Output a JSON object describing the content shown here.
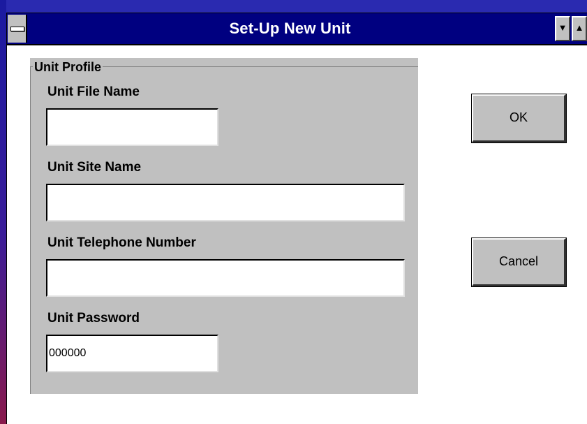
{
  "window": {
    "title": "Set-Up New Unit",
    "minimize_glyph": "▼",
    "maximize_glyph": "▲"
  },
  "group": {
    "legend": "Unit Profile"
  },
  "fields": {
    "unit_file_name": {
      "label": "Unit File Name",
      "value": ""
    },
    "unit_site_name": {
      "label": "Unit Site Name",
      "value": ""
    },
    "unit_telephone_number": {
      "label": "Unit Telephone Number",
      "value": ""
    },
    "unit_password": {
      "label": "Unit Password",
      "value": "000000"
    }
  },
  "buttons": {
    "ok": "OK",
    "cancel": "Cancel"
  },
  "colors": {
    "title_bar": "#000080",
    "dialog_face": "#c0c0c0"
  }
}
